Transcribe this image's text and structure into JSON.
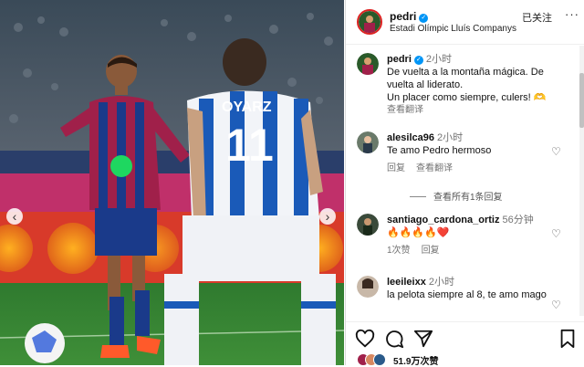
{
  "photo": {
    "player_back_name": "OYARZ",
    "player_back_number": "11",
    "prev_label": "‹",
    "next_label": "›"
  },
  "header": {
    "username": "pedri",
    "verified_mark": "✓",
    "location": "Estadi Olímpic Lluís Companys",
    "follow_status": "已关注",
    "more": "···"
  },
  "caption": {
    "username": "pedri",
    "time": "2小时",
    "text": "De vuelta a la montaña mágica. De vuelta al liderato.",
    "text2": "Un placer como siempre, culers! 🫶",
    "translate": "查看翻译"
  },
  "comments": [
    {
      "username": "alesilca96",
      "time": "2小时",
      "text": "Te amo Pedro hermoso",
      "reply": "回复",
      "translate": "查看翻译"
    },
    {
      "username": "santiago_cardona_ortiz",
      "time": "56分钟",
      "text": "🔥🔥🔥🔥❤️",
      "likes": "1次赞",
      "reply": "回复"
    },
    {
      "username": "leeileixx",
      "time": "2小时",
      "text": "la pelota siempre al 8, te amo mago"
    }
  ],
  "view_replies": "查看所有1条回复",
  "footer": {
    "likes": "51.9万次赞"
  },
  "colors": {
    "accent": "#0095f6",
    "text_secondary": "#737373"
  }
}
